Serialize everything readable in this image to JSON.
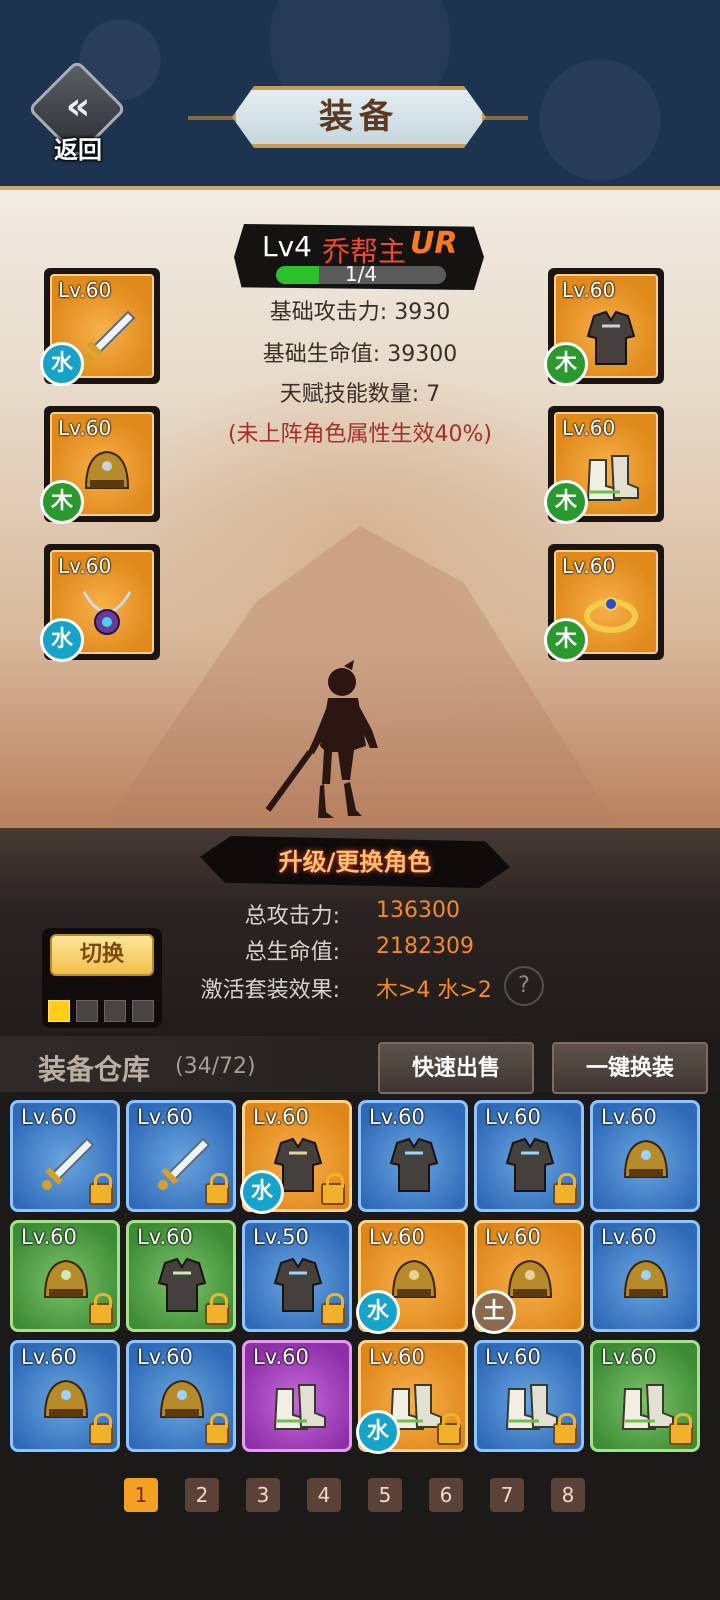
{
  "header": {
    "back_label": "返回",
    "title": "装备"
  },
  "character": {
    "level": "Lv4",
    "name": "乔帮主",
    "rarity": "UR",
    "progress_text": "1/4",
    "progress_fraction": 0.25,
    "stats": {
      "attack": "基础攻击力: 3930",
      "hp": "基础生命值: 39300",
      "talent": "天赋技能数量: 7",
      "note": "(未上阵角色属性生效40%)"
    }
  },
  "equipped_slots": [
    {
      "level": "Lv.60",
      "element": "水",
      "art": "sword"
    },
    {
      "level": "Lv.60",
      "element": "木",
      "art": "armor"
    },
    {
      "level": "Lv.60",
      "element": "木",
      "art": "helmet"
    },
    {
      "level": "Lv.60",
      "element": "木",
      "art": "boots"
    },
    {
      "level": "Lv.60",
      "element": "水",
      "art": "necklace"
    },
    {
      "level": "Lv.60",
      "element": "木",
      "art": "ring"
    }
  ],
  "upgrade_button": "升级/更换角色",
  "totals": {
    "attack_label": "总攻击力:",
    "attack_value": "136300",
    "hp_label": "总生命值:",
    "hp_value": "2182309",
    "set_label": "激活套装效果:",
    "set_value": "木>4  水>2",
    "help": "?"
  },
  "switch": {
    "label": "切换",
    "pages": 4,
    "active_page": 1
  },
  "warehouse": {
    "title": "装备仓库",
    "count": "(34/72)",
    "quick_sell": "快速出售",
    "one_click_equip": "一键换装"
  },
  "inventory": [
    {
      "level": "Lv.60",
      "rarity": "blue",
      "art": "sword",
      "locked": true,
      "element": ""
    },
    {
      "level": "Lv.60",
      "rarity": "blue",
      "art": "sword",
      "locked": true,
      "element": ""
    },
    {
      "level": "Lv.60",
      "rarity": "orange",
      "art": "armor",
      "locked": true,
      "element": "水"
    },
    {
      "level": "Lv.60",
      "rarity": "blue",
      "art": "armor",
      "locked": false,
      "element": ""
    },
    {
      "level": "Lv.60",
      "rarity": "blue",
      "art": "armor",
      "locked": true,
      "element": ""
    },
    {
      "level": "Lv.60",
      "rarity": "blue",
      "art": "helmet",
      "locked": false,
      "element": ""
    },
    {
      "level": "Lv.60",
      "rarity": "green",
      "art": "helmet",
      "locked": true,
      "element": ""
    },
    {
      "level": "Lv.60",
      "rarity": "green",
      "art": "armor",
      "locked": true,
      "element": ""
    },
    {
      "level": "Lv.50",
      "rarity": "blue",
      "art": "armor",
      "locked": true,
      "element": ""
    },
    {
      "level": "Lv.60",
      "rarity": "orange",
      "art": "helmet",
      "locked": false,
      "element": "水"
    },
    {
      "level": "Lv.60",
      "rarity": "orange",
      "art": "helmet",
      "locked": false,
      "element": "土"
    },
    {
      "level": "Lv.60",
      "rarity": "blue",
      "art": "helmet",
      "locked": false,
      "element": ""
    },
    {
      "level": "Lv.60",
      "rarity": "blue",
      "art": "helmet",
      "locked": true,
      "element": ""
    },
    {
      "level": "Lv.60",
      "rarity": "blue",
      "art": "helmet",
      "locked": true,
      "element": ""
    },
    {
      "level": "Lv.60",
      "rarity": "purple",
      "art": "boots",
      "locked": false,
      "element": ""
    },
    {
      "level": "Lv.60",
      "rarity": "orange",
      "art": "boots",
      "locked": true,
      "element": "水"
    },
    {
      "level": "Lv.60",
      "rarity": "blue",
      "art": "boots",
      "locked": true,
      "element": ""
    },
    {
      "level": "Lv.60",
      "rarity": "green",
      "art": "boots",
      "locked": true,
      "element": ""
    }
  ],
  "pagination": {
    "pages": [
      "1",
      "2",
      "3",
      "4",
      "5",
      "6",
      "7",
      "8"
    ],
    "current": "1"
  },
  "colors": {
    "water": "#16a3c9",
    "wood": "#2a9a2e",
    "earth": "#8c6a4f",
    "accent_orange": "#f48a2a"
  }
}
